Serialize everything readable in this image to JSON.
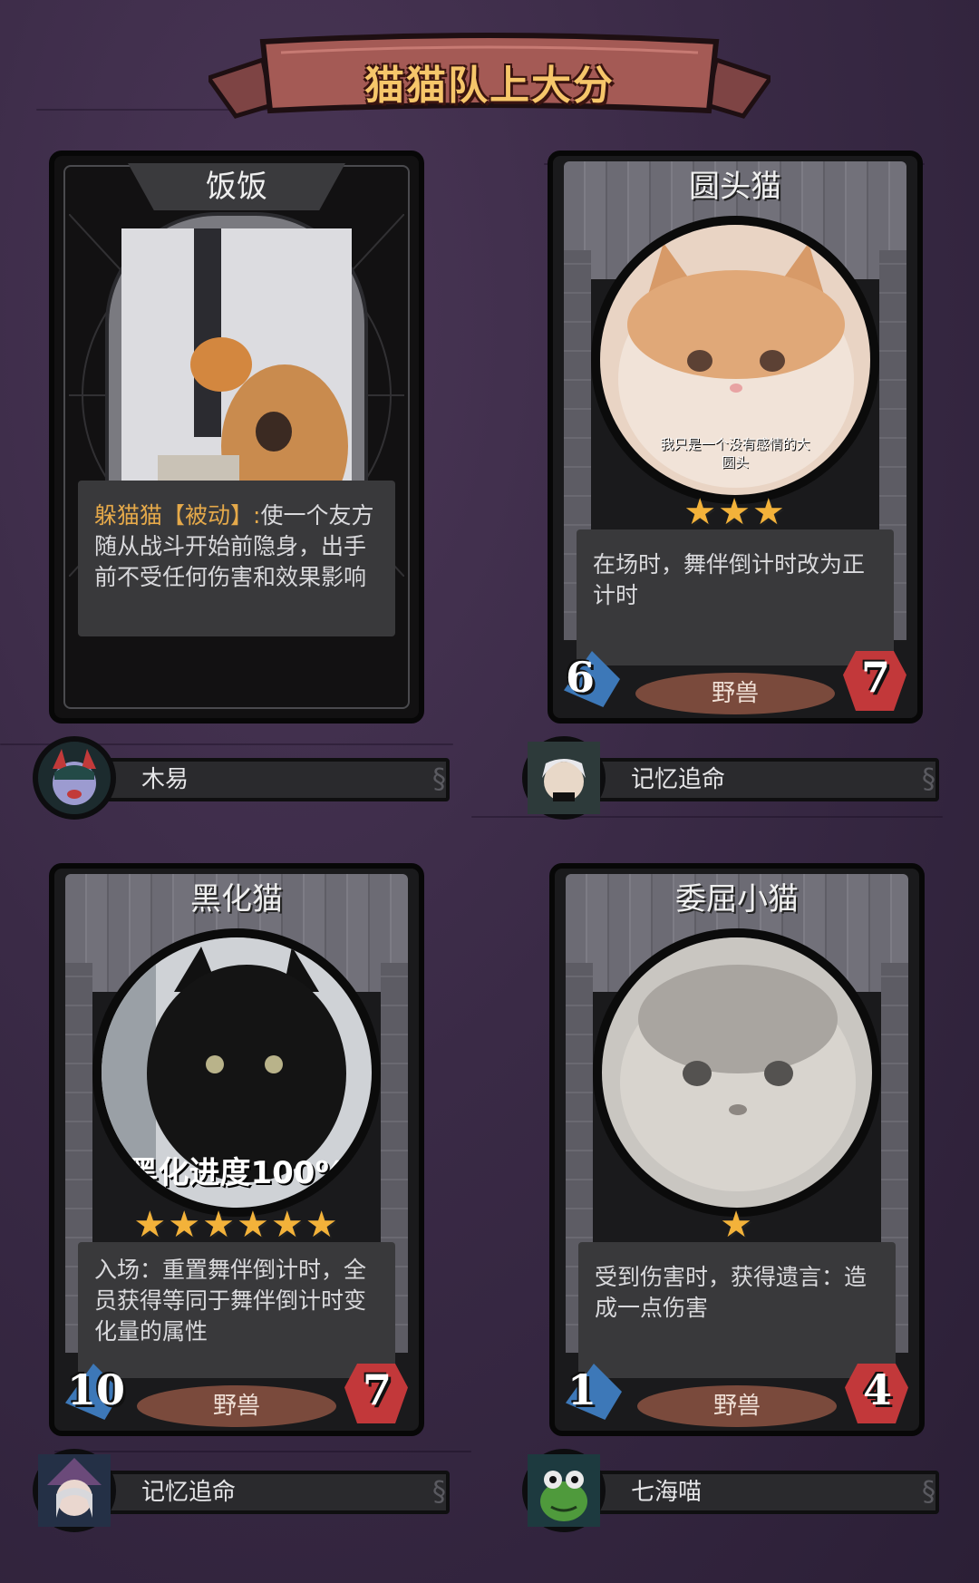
{
  "banner": {
    "title": "猫猫队上大分"
  },
  "cards": [
    {
      "name": "饭饭",
      "kind": "hero",
      "desc_key": "躲猫猫【被动】:",
      "desc": "使一个友方随从战斗开始前隐身，出手前不受任何伤害和效果影响",
      "owner": "木易"
    },
    {
      "name": "圆头猫",
      "kind": "minion",
      "caption": "我只是一个没有感情的大圆头",
      "stars": "★★★",
      "desc": "在场时，舞伴倒计时改为正计时",
      "attack": "6",
      "health": "7",
      "tribe": "野兽",
      "owner": "记忆追命"
    },
    {
      "name": "黑化猫",
      "kind": "minion",
      "caption": "黑化进度100%",
      "stars": "★★★★★★",
      "desc": "入场：重置舞伴倒计时，全员获得等同于舞伴倒计时变化量的属性",
      "attack": "10",
      "health": "7",
      "tribe": "野兽",
      "owner": "记忆追命"
    },
    {
      "name": "委屈小猫",
      "kind": "minion",
      "stars": "★",
      "desc": "受到伤害时，获得遗言：造成一点伤害",
      "attack": "1",
      "health": "4",
      "tribe": "野兽",
      "owner": "七海喵"
    }
  ]
}
